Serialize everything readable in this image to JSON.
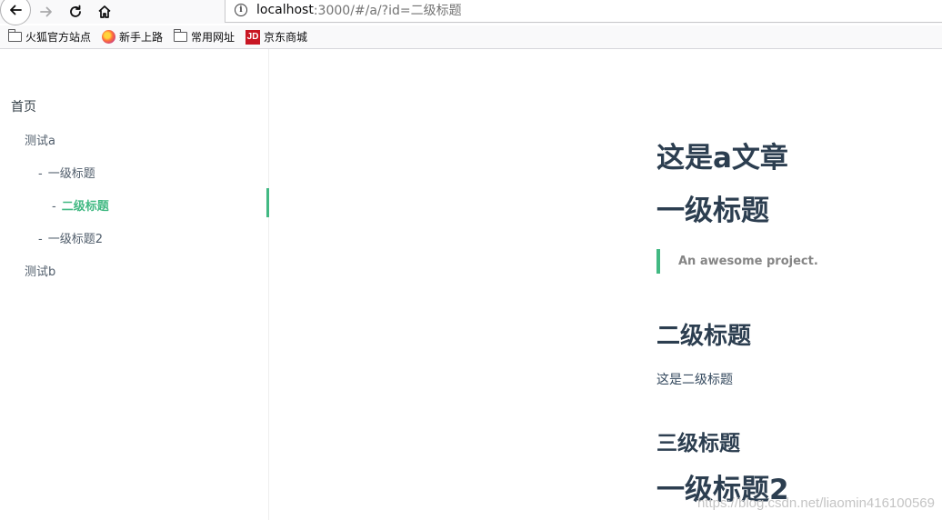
{
  "browser": {
    "url_host": "localhost",
    "url_rest": ":3000/#/a/?id=二级标题",
    "bookmarks": [
      {
        "label": "火狐官方站点",
        "icon": "folder-icon"
      },
      {
        "label": "新手上路",
        "icon": "firefox-icon"
      },
      {
        "label": "常用网址",
        "icon": "folder-icon"
      },
      {
        "label": "京东商城",
        "icon": "jd-icon"
      }
    ],
    "jd_logo_text": "JD"
  },
  "sidebar": {
    "home": "首页",
    "test_a": "测试a",
    "h1_item": "一级标题",
    "h2_item": "二级标题",
    "h1_item2": "一级标题2",
    "test_b": "测试b",
    "dash": "-"
  },
  "content": {
    "h1_article": "这是a文章",
    "h1": "一级标题",
    "blockquote": "An awesome project.",
    "h2": "二级标题",
    "paragraph": "这是二级标题",
    "h3": "三级标题",
    "h1_2": "一级标题2"
  },
  "watermark": "https://blog.csdn.net/liaomin416100569",
  "colors": {
    "accent": "#42b983",
    "heading": "#2c3e50",
    "text": "#34495e"
  }
}
